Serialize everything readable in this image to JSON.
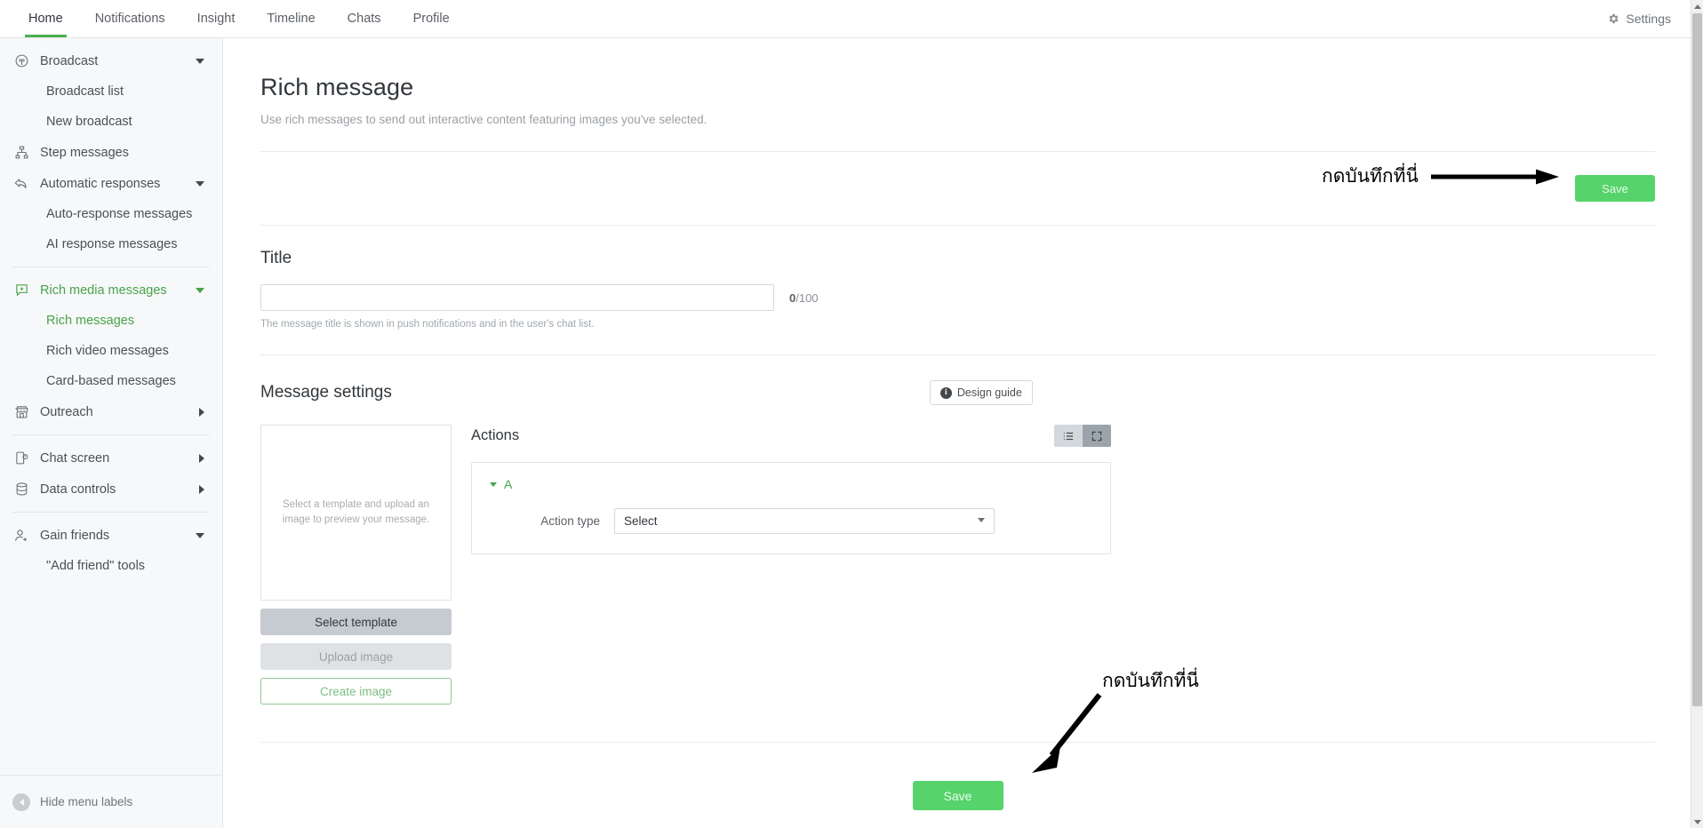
{
  "topnav": {
    "items": [
      {
        "label": "Home",
        "active": true
      },
      {
        "label": "Notifications",
        "active": false
      },
      {
        "label": "Insight",
        "active": false
      },
      {
        "label": "Timeline",
        "active": false
      },
      {
        "label": "Chats",
        "active": false
      },
      {
        "label": "Profile",
        "active": false
      }
    ],
    "settings_label": "Settings",
    "settings_icon": "gear-icon"
  },
  "sidebar": {
    "items": [
      {
        "label": "Broadcast",
        "icon": "broadcast-antenna-icon",
        "expander": "caret-down",
        "level": 0,
        "active": false
      },
      {
        "label": "Broadcast list",
        "level": 1,
        "active": false
      },
      {
        "label": "New broadcast",
        "level": 1,
        "active": false
      },
      {
        "label": "Step messages",
        "icon": "step-hierarchy-icon",
        "level": 0,
        "active": false
      },
      {
        "label": "Automatic responses",
        "icon": "reply-arrow-icon",
        "expander": "caret-down",
        "level": 0,
        "active": false
      },
      {
        "label": "Auto-response messages",
        "level": 1,
        "active": false
      },
      {
        "label": "AI response messages",
        "level": 1,
        "active": false
      },
      {
        "label": "Rich media messages",
        "icon": "rich-media-plus-icon",
        "expander": "caret-down",
        "level": 0,
        "active": true
      },
      {
        "label": "Rich messages",
        "level": 1,
        "active": true
      },
      {
        "label": "Rich video messages",
        "level": 1,
        "active": false
      },
      {
        "label": "Card-based messages",
        "level": 1,
        "active": false
      },
      {
        "label": "Outreach",
        "icon": "storefront-icon",
        "expander": "caret-right",
        "level": 0,
        "active": false
      },
      {
        "label": "Chat screen",
        "icon": "chat-screen-icon",
        "expander": "caret-right",
        "level": 0,
        "active": false
      },
      {
        "label": "Data controls",
        "icon": "database-icon",
        "expander": "caret-right",
        "level": 0,
        "active": false
      },
      {
        "label": "Gain friends",
        "icon": "add-friend-icon",
        "expander": "caret-down",
        "level": 0,
        "active": false
      },
      {
        "label": "\"Add friend\" tools",
        "level": 1,
        "active": false
      }
    ],
    "collapse_label": "Hide menu labels",
    "collapse_icon": "chevron-left-circle-icon"
  },
  "page": {
    "title": "Rich message",
    "subtitle": "Use rich messages to send out interactive content featuring images you've selected.",
    "save_top_label": "Save",
    "save_bottom_label": "Save"
  },
  "title_section": {
    "heading": "Title",
    "value": "",
    "placeholder": "",
    "counter_current": "0",
    "counter_max": "/100",
    "helper": "The message title is shown in push notifications and in the user's chat list."
  },
  "message_settings": {
    "heading": "Message settings",
    "design_guide_label": "Design guide",
    "design_guide_icon": "info-icon",
    "preview_placeholder": "Select a template and upload an image to preview your message.",
    "buttons": [
      {
        "label": "Select template",
        "name": "select-template-button"
      },
      {
        "label": "Upload image",
        "name": "upload-image-button"
      },
      {
        "label": "Create image",
        "name": "create-image-button"
      }
    ]
  },
  "actions": {
    "heading": "Actions",
    "view_list_icon": "list-view-icon",
    "view_expand_icon": "expand-view-icon",
    "blocks": [
      {
        "label": "A",
        "field_label": "Action type",
        "select_value": "Select",
        "select_icon": "chevron-down-icon"
      }
    ]
  },
  "annotations": [
    {
      "text": "กดบันทึกที่นี่",
      "name": "annotation-top",
      "direction": "right"
    },
    {
      "text": "กดบันทึกที่นี่",
      "name": "annotation-bottom",
      "direction": "down-left"
    }
  ],
  "colors": {
    "brand_green": "#47a34a",
    "save_green": "#56d36b",
    "nav_active_underline": "#4caf50",
    "sidebar_bg": "#f7f8f9",
    "border": "#e3e5e8"
  }
}
